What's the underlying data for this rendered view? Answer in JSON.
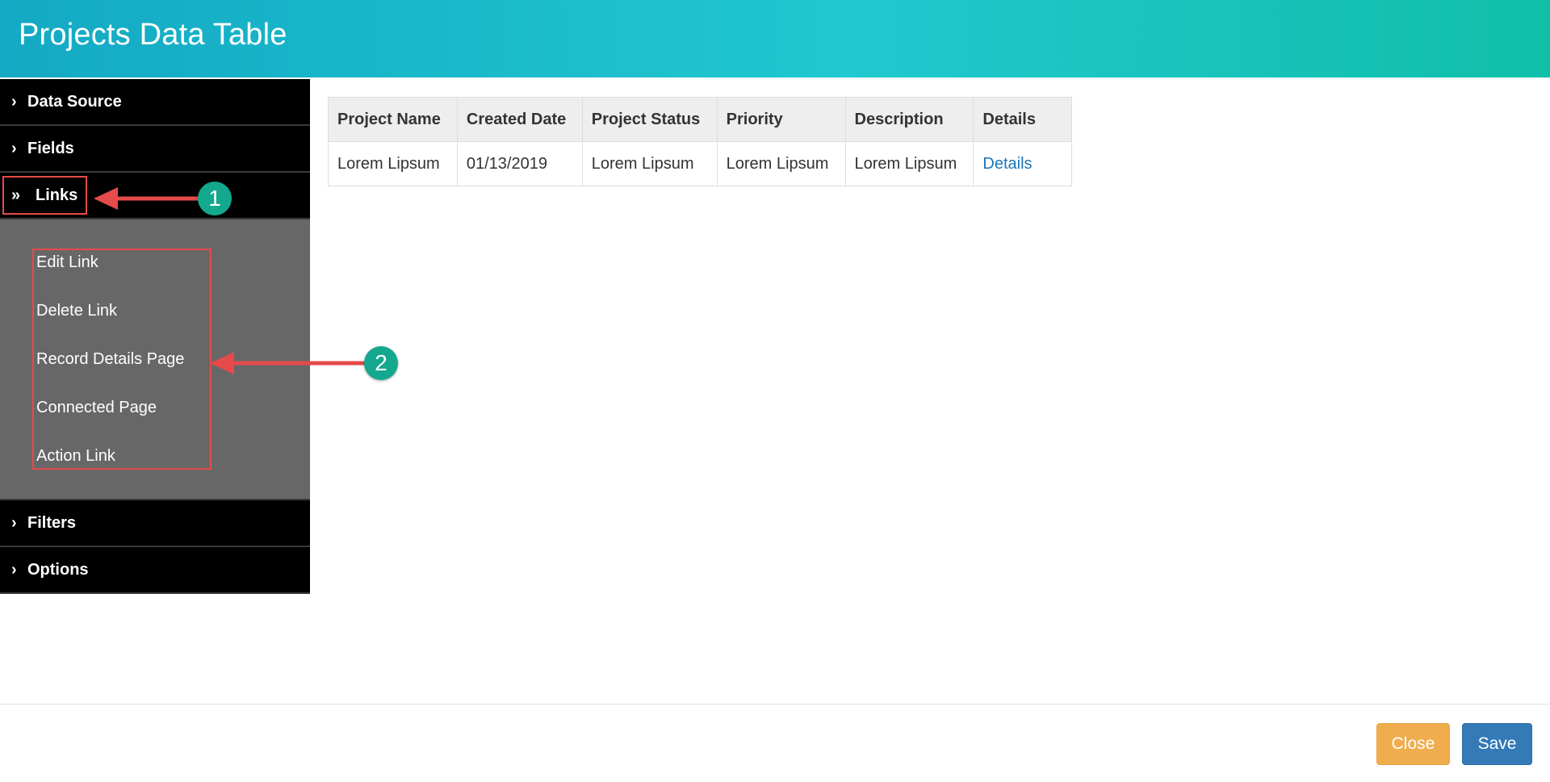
{
  "header": {
    "title": "Projects Data Table"
  },
  "sidebar": {
    "sections": [
      {
        "label": "Data Source",
        "icon": "chevron-right-icon"
      },
      {
        "label": "Fields",
        "icon": "chevron-right-icon"
      },
      {
        "label": "Links",
        "icon": "double-chevron-right-icon"
      },
      {
        "label": "Filters",
        "icon": "chevron-right-icon"
      },
      {
        "label": "Options",
        "icon": "chevron-right-icon"
      }
    ],
    "links_submenu": [
      "Edit Link",
      "Delete Link",
      "Record Details Page",
      "Connected Page",
      "Action Link"
    ]
  },
  "annotations": {
    "badge1": "1",
    "badge2": "2",
    "highlight_color": "#e64a4a",
    "badge_color": "#14a88e"
  },
  "table": {
    "headers": [
      "Project Name",
      "Created Date",
      "Project Status",
      "Priority",
      "Description",
      "Details"
    ],
    "rows": [
      [
        "Lorem Lipsum",
        "01/13/2019",
        "Lorem Lipsum",
        "Lorem Lipsum",
        "Lorem Lipsum",
        "Details"
      ]
    ]
  },
  "footer": {
    "close_label": "Close",
    "save_label": "Save"
  },
  "colors": {
    "header_gradient": [
      "#14a9c4",
      "#20c8cf",
      "#10bfa8"
    ],
    "close_button": "#f0ad4e",
    "save_button": "#337ab7",
    "link": "#1a75b6"
  }
}
